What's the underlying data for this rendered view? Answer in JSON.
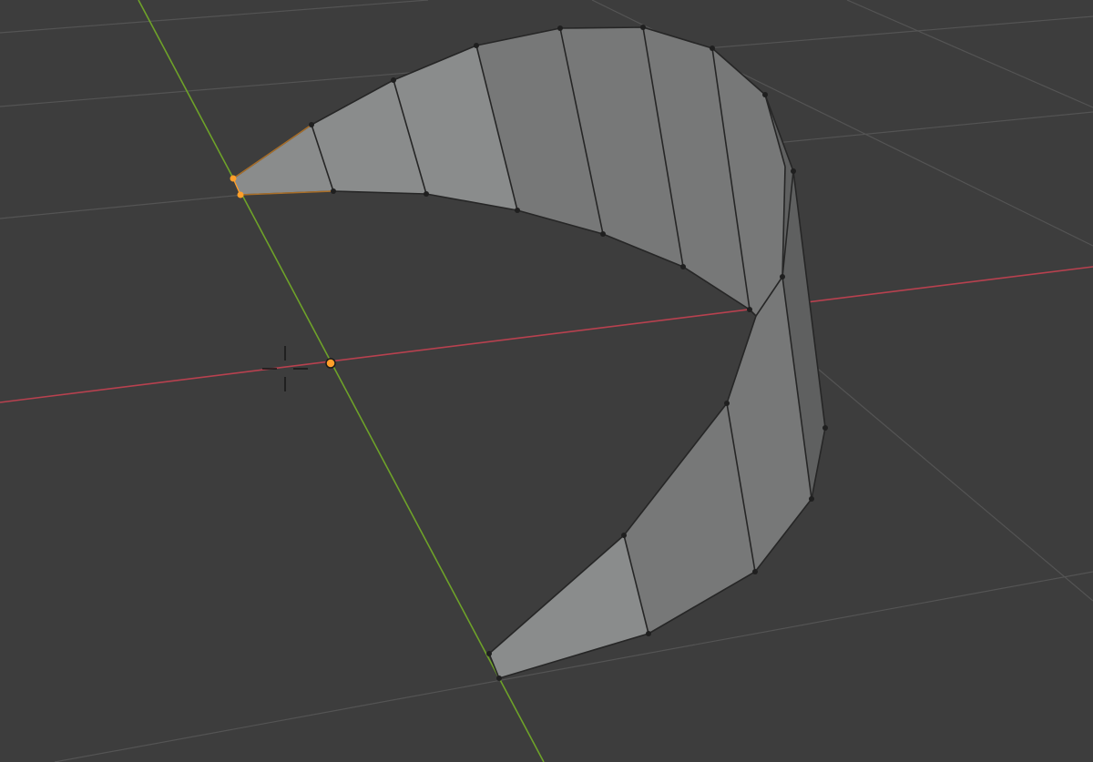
{
  "viewport": {
    "background": "#3d3d3d",
    "grid_color": "#545454",
    "x_axis_color": "#b8414f",
    "y_axis_color": "#6ea229"
  },
  "mesh": {
    "face_color_light": "#8a8c8c",
    "face_color_mid": "#777878",
    "face_color_dark": "#5f6060",
    "edge_color": "#262626",
    "vertex_color": "#1f1f1f",
    "selected_color": "#ff9f2a"
  },
  "cursor": {
    "icon": "3d-cursor-icon",
    "ring_color": "#e8e8e8",
    "accent_color": "#d04848"
  },
  "origin": {
    "icon": "object-origin-icon",
    "color": "#ff9f2a"
  }
}
